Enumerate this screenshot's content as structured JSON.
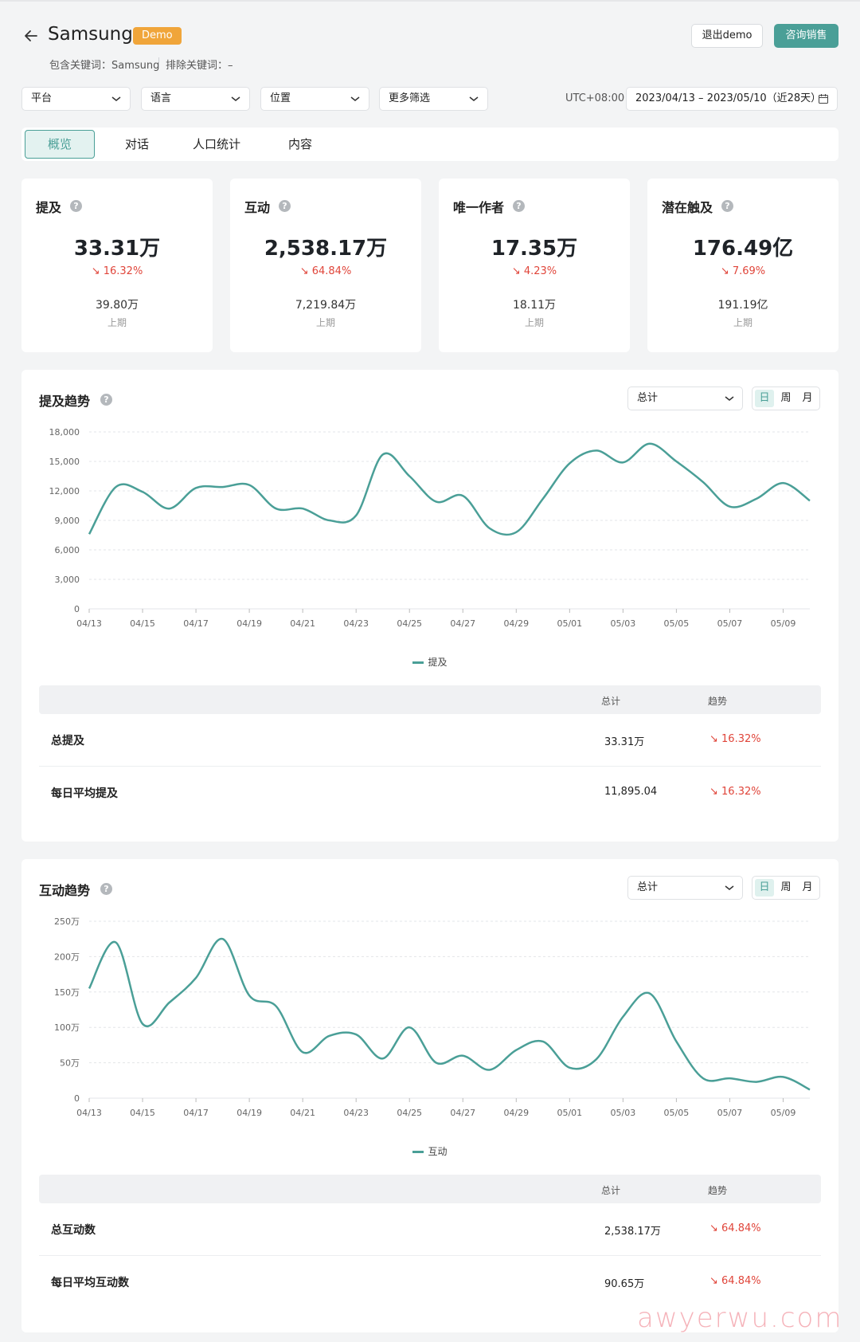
{
  "header": {
    "brand": "Samsung",
    "badge": "Demo",
    "include_keywords": "包含关键词：Samsung",
    "exclude_keywords": "排除关键词：–",
    "exit_button": "退出demo",
    "contact_button": "咨询销售"
  },
  "filters": {
    "platform": "平台",
    "language": "语言",
    "location": "位置",
    "more": "更多筛选",
    "timezone": "UTC+08:00",
    "date_range": "2023/04/13 – 2023/05/10（近28天）"
  },
  "tabs": [
    "概览",
    "对话",
    "人口统计",
    "内容"
  ],
  "active_tab": 0,
  "metrics": [
    {
      "title": "提及",
      "value": "33.31万",
      "change": "↘ 16.32%",
      "previous": "39.80万",
      "previous_label": "上期"
    },
    {
      "title": "互动",
      "value": "2,538.17万",
      "change": "↘ 64.84%",
      "previous": "7,219.84万",
      "previous_label": "上期"
    },
    {
      "title": "唯一作者",
      "value": "17.35万",
      "change": "↘ 4.23%",
      "previous": "18.11万",
      "previous_label": "上期"
    },
    {
      "title": "潜在触及",
      "value": "176.49亿",
      "change": "↘ 7.69%",
      "previous": "191.19亿",
      "previous_label": "上期"
    }
  ],
  "granularity": [
    "日",
    "周",
    "月"
  ],
  "colors": {
    "accent": "#4a9f97",
    "decline": "#e0453a",
    "badge": "#f0a53a"
  },
  "mentions_panel": {
    "title": "提及趋势",
    "aggregation": "总计",
    "table": {
      "col_total": "总计",
      "col_trend": "趋势",
      "rows": [
        {
          "label": "总提及",
          "total": "33.31万",
          "trend": "↘ 16.32%"
        },
        {
          "label": "每日平均提及",
          "total": "11,895.04",
          "trend": "↘ 16.32%"
        }
      ]
    }
  },
  "engagement_panel": {
    "title": "互动趋势",
    "aggregation": "总计",
    "table": {
      "col_total": "总计",
      "col_trend": "趋势",
      "rows": [
        {
          "label": "总互动数",
          "total": "2,538.17万",
          "trend": "↘ 64.84%"
        },
        {
          "label": "每日平均互动数",
          "total": "90.65万",
          "trend": "↘ 64.84%"
        }
      ]
    }
  },
  "chart_data": [
    {
      "type": "line",
      "x": [
        "04/13",
        "04/14",
        "04/15",
        "04/16",
        "04/17",
        "04/18",
        "04/19",
        "04/20",
        "04/21",
        "04/22",
        "04/23",
        "04/24",
        "04/25",
        "04/26",
        "04/27",
        "04/28",
        "04/29",
        "04/30",
        "05/01",
        "05/02",
        "05/03",
        "05/04",
        "05/05",
        "05/06",
        "05/07",
        "05/08",
        "05/09",
        "05/10"
      ],
      "x_tick_labels": [
        "04/13",
        "04/15",
        "04/17",
        "04/19",
        "04/21",
        "04/23",
        "04/25",
        "04/27",
        "04/29",
        "05/01",
        "05/03",
        "05/05",
        "05/07",
        "05/09"
      ],
      "series": [
        {
          "name": "提及",
          "values": [
            7600,
            12400,
            11900,
            10200,
            12300,
            12400,
            12600,
            10200,
            10200,
            9000,
            9500,
            15700,
            13500,
            10900,
            11500,
            8200,
            7800,
            11200,
            14800,
            16100,
            14900,
            16800,
            15000,
            12900,
            10400,
            11200,
            12800,
            11000
          ]
        }
      ],
      "yticks": [
        "0",
        "3,000",
        "6,000",
        "9,000",
        "12,000",
        "15,000",
        "18,000"
      ],
      "ylim": [
        0,
        18000
      ],
      "grid": true,
      "legend": "bottom-center"
    },
    {
      "type": "line",
      "x": [
        "04/13",
        "04/14",
        "04/15",
        "04/16",
        "04/17",
        "04/18",
        "04/19",
        "04/20",
        "04/21",
        "04/22",
        "04/23",
        "04/24",
        "04/25",
        "04/26",
        "04/27",
        "04/28",
        "04/29",
        "04/30",
        "05/01",
        "05/02",
        "05/03",
        "05/04",
        "05/05",
        "05/06",
        "05/07",
        "05/08",
        "05/09",
        "05/10"
      ],
      "x_tick_labels": [
        "04/13",
        "04/15",
        "04/17",
        "04/19",
        "04/21",
        "04/23",
        "04/25",
        "04/27",
        "04/29",
        "05/01",
        "05/03",
        "05/05",
        "05/07",
        "05/09"
      ],
      "series": [
        {
          "name": "互动",
          "values": [
            155,
            220,
            105,
            135,
            170,
            225,
            145,
            130,
            65,
            88,
            90,
            56,
            100,
            50,
            60,
            40,
            68,
            80,
            43,
            55,
            115,
            148,
            80,
            28,
            28,
            23,
            30,
            12
          ]
        }
      ],
      "y_unit": "万",
      "yticks": [
        "0",
        "50万",
        "100万",
        "150万",
        "200万",
        "250万"
      ],
      "ylim": [
        0,
        250
      ],
      "grid": true,
      "legend": "bottom-center"
    }
  ]
}
